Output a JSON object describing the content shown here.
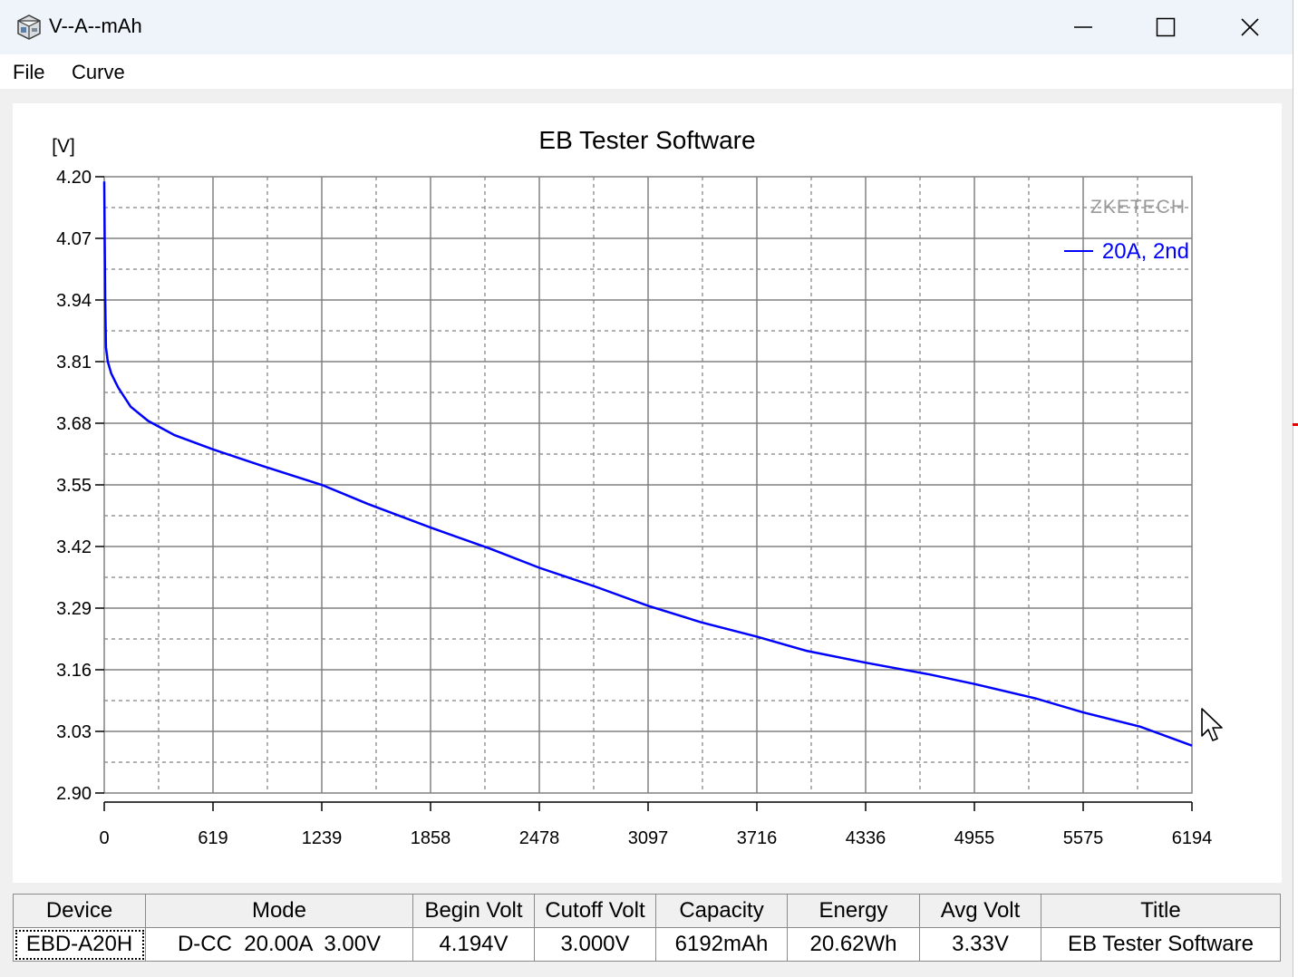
{
  "window": {
    "title": "V--A--mAh",
    "controls": [
      "minimize",
      "maximize",
      "close"
    ]
  },
  "menu": {
    "items": [
      {
        "label": "File"
      },
      {
        "label": "Curve"
      }
    ]
  },
  "chart_data": {
    "type": "line",
    "title": "EB Tester Software",
    "ylabel": "[V]",
    "xlabel": "",
    "watermark": "ZKETECH",
    "ylim": [
      2.9,
      4.2
    ],
    "xlim": [
      0,
      6194
    ],
    "yticks": [
      "4.20",
      "4.07",
      "3.94",
      "3.81",
      "3.68",
      "3.55",
      "3.42",
      "3.29",
      "3.16",
      "3.03",
      "2.90"
    ],
    "xticks": [
      "0",
      "619",
      "1239",
      "1858",
      "2478",
      "3097",
      "3716",
      "4336",
      "4955",
      "5575",
      "6194"
    ],
    "grid": true,
    "legend_position": "top-right",
    "series": [
      {
        "name": "20A, 2nd",
        "color": "#0000ff",
        "x": [
          0,
          5,
          10,
          20,
          40,
          80,
          150,
          250,
          400,
          619,
          900,
          1239,
          1500,
          1858,
          2200,
          2478,
          2800,
          3097,
          3400,
          3716,
          4000,
          4336,
          4700,
          4955,
          5300,
          5575,
          5900,
          6194
        ],
        "y": [
          4.19,
          3.95,
          3.84,
          3.81,
          3.785,
          3.755,
          3.715,
          3.685,
          3.655,
          3.625,
          3.59,
          3.55,
          3.51,
          3.46,
          3.415,
          3.375,
          3.335,
          3.295,
          3.26,
          3.23,
          3.2,
          3.175,
          3.15,
          3.13,
          3.1,
          3.07,
          3.04,
          3.0
        ]
      }
    ]
  },
  "table": {
    "headers": [
      "Device",
      "Mode",
      "Begin Volt",
      "Cutoff Volt",
      "Capacity",
      "Energy",
      "Avg Volt",
      "Title"
    ],
    "rows": [
      [
        "EBD-A20H",
        "D-CC  20.00A  3.00V",
        "4.194V",
        "3.000V",
        "6192mAh",
        "20.62Wh",
        "3.33V",
        "EB Tester Software"
      ]
    ]
  }
}
